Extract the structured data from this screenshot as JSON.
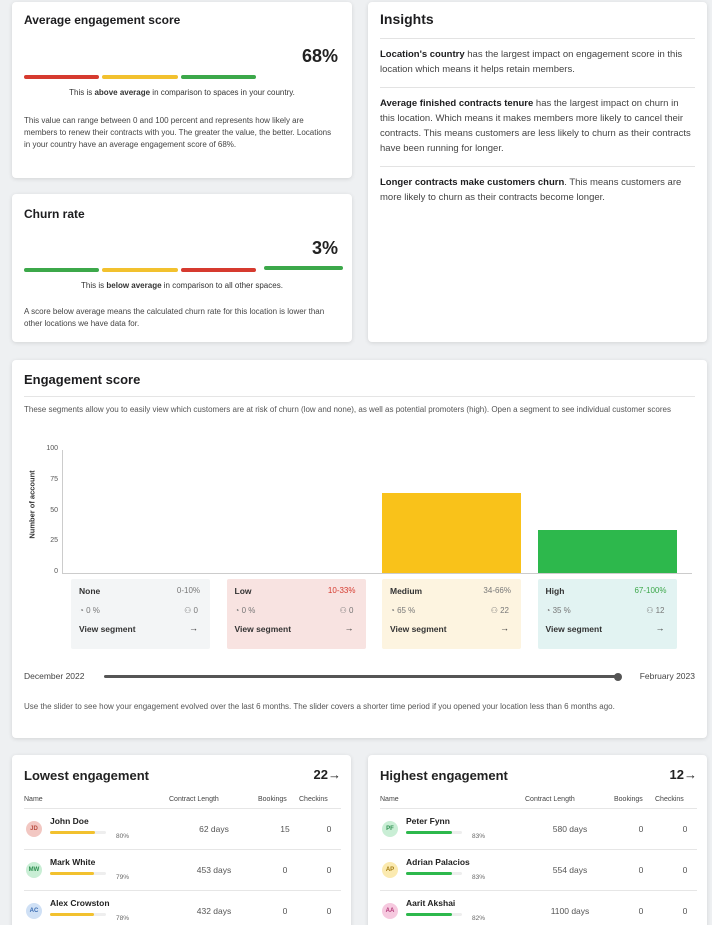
{
  "avg_engagement": {
    "title": "Average engagement score",
    "value": "68%",
    "note_prefix": "This is ",
    "note_bold": "above average",
    "note_suffix": " in comparison to spaces in your country.",
    "description": "This value can range between 0 and 100 percent and represents how likely are members to renew their contracts with you. The greater the value, the better. Locations in your country have an average engagement score of 68%.",
    "colors": [
      "#d63a2f",
      "#f2c12e",
      "#3ca84a"
    ],
    "marker_fraction": 0.68
  },
  "churn": {
    "title": "Churn rate",
    "value": "3%",
    "note_prefix": "This is ",
    "note_bold": "below average",
    "note_suffix": " in comparison to all other spaces.",
    "description": "A score below average means the calculated churn rate for this location is lower than other locations we have data for.",
    "colors": [
      "#3ca84a",
      "#f2c12e",
      "#d63a2f"
    ],
    "marker_fraction": 0.03
  },
  "insights": {
    "title": "Insights",
    "items": [
      {
        "bold": "Location's country",
        "text": " has the largest impact on engagement score in this location which means it helps retain members."
      },
      {
        "bold": "Average finished contracts tenure",
        "text": " has the largest impact on churn in this location. Which means it makes members more likely to cancel their contracts. This means customers are less likely to churn as their contracts have been running for longer."
      },
      {
        "bold": "Longer contracts make customers churn",
        "text": ". This means customers are more likely to churn as their contracts become longer."
      }
    ]
  },
  "engagement_score": {
    "title": "Engagement score",
    "subtitle": "These segments allow you to easily view which customers are at risk of churn (low and none), as well as potential promoters (high). Open a segment to see individual customer scores",
    "ylabel": "Number of account",
    "yticks": [
      "100",
      "75",
      "50",
      "25",
      "0"
    ],
    "segments": [
      {
        "name": "None",
        "range": "0-10%",
        "pct": "0 %",
        "count": "0",
        "view": "View segment",
        "bg": "#f3f5f6",
        "range_color": "#777"
      },
      {
        "name": "Low",
        "range": "10-33%",
        "pct": "0 %",
        "count": "0",
        "view": "View segment",
        "bg": "#f8e3e1",
        "range_color": "#d63a2f"
      },
      {
        "name": "Medium",
        "range": "34-66%",
        "pct": "65 %",
        "count": "22",
        "view": "View segment",
        "bg": "#fdf4e0",
        "range_color": "#777"
      },
      {
        "name": "High",
        "range": "67-100%",
        "pct": "35 %",
        "count": "12",
        "view": "View segment",
        "bg": "#e2f3f2",
        "range_color": "#3ca84a"
      }
    ],
    "slider_start": "December 2022",
    "slider_end": "February 2023",
    "slider_fraction": 1.0,
    "slider_note": "Use the slider to see how your engagement evolved over the last 6 months. The slider covers a shorter time period if you opened your location less than 6 months ago."
  },
  "chart_data": {
    "type": "bar",
    "categories": [
      "None",
      "Low",
      "Medium",
      "High"
    ],
    "values": [
      0,
      0,
      65,
      35
    ],
    "ylim": [
      0,
      100
    ],
    "ylabel": "Number of account",
    "colors": [
      "#f2c12e",
      "#f2c12e",
      "#f9c21a",
      "#2db84c"
    ]
  },
  "lowest": {
    "title": "Lowest engagement",
    "count": "22",
    "headers": [
      "Name",
      "Contract Length",
      "Bookings",
      "Checkins"
    ],
    "rows": [
      {
        "initials": "JD",
        "name": "John Doe",
        "pct": "80%",
        "fraction": 0.8,
        "contract": "62 days",
        "bookings": "15",
        "checkins": "0",
        "avatar_bg": "#f2c7c2",
        "avatar_fg": "#b84a3e",
        "bar": "#f2c12e"
      },
      {
        "initials": "MW",
        "name": "Mark White",
        "pct": "79%",
        "fraction": 0.79,
        "contract": "453 days",
        "bookings": "0",
        "checkins": "0",
        "avatar_bg": "#c9eed5",
        "avatar_fg": "#2c8f4f",
        "bar": "#f2c12e"
      },
      {
        "initials": "AC",
        "name": "Alex Crowston",
        "pct": "78%",
        "fraction": 0.78,
        "contract": "432 days",
        "bookings": "0",
        "checkins": "0",
        "avatar_bg": "#cfe0f5",
        "avatar_fg": "#3b6db3",
        "bar": "#f2c12e"
      }
    ]
  },
  "highest": {
    "title": "Highest engagement",
    "count": "12",
    "headers": [
      "Name",
      "Contract Length",
      "Bookings",
      "Checkins"
    ],
    "rows": [
      {
        "initials": "PF",
        "name": "Peter Fynn",
        "pct": "83%",
        "fraction": 0.83,
        "contract": "580 days",
        "bookings": "0",
        "checkins": "0",
        "avatar_bg": "#c9eed5",
        "avatar_fg": "#2c8f4f",
        "bar": "#2db84c"
      },
      {
        "initials": "AP",
        "name": "Adrian Palacios",
        "pct": "83%",
        "fraction": 0.83,
        "contract": "554 days",
        "bookings": "0",
        "checkins": "0",
        "avatar_bg": "#fbeab0",
        "avatar_fg": "#a27a10",
        "bar": "#2db84c"
      },
      {
        "initials": "AA",
        "name": "Aarit Akshai",
        "pct": "82%",
        "fraction": 0.82,
        "contract": "1100 days",
        "bookings": "0",
        "checkins": "0",
        "avatar_bg": "#f6c9df",
        "avatar_fg": "#b23a78",
        "bar": "#2db84c"
      }
    ]
  }
}
